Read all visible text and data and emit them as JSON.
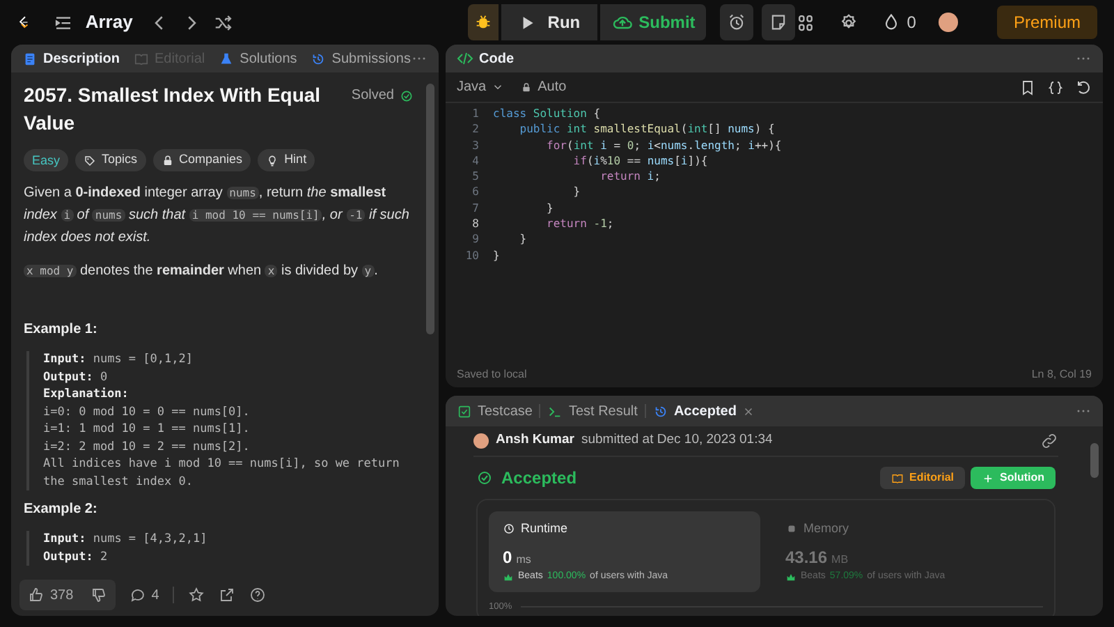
{
  "topbar": {
    "problem_list": "Array",
    "run": "Run",
    "submit": "Submit",
    "streak": "0",
    "premium": "Premium"
  },
  "left_tabs": [
    {
      "label": "Description",
      "selected": true,
      "disabled": false
    },
    {
      "label": "Editorial",
      "selected": false,
      "disabled": true
    },
    {
      "label": "Solutions",
      "selected": false,
      "disabled": false
    },
    {
      "label": "Submissions",
      "selected": false,
      "disabled": false
    }
  ],
  "problem": {
    "title": "2057. Smallest Index With Equal Value",
    "status": "Solved",
    "difficulty": "Easy",
    "tags": [
      {
        "label": "Topics"
      },
      {
        "label": "Companies"
      },
      {
        "label": "Hint"
      }
    ],
    "paragraphs": [
      [
        {
          "kind": "text",
          "text": "Given a **0-indexed** integer array "
        },
        {
          "kind": "code",
          "text": "nums"
        },
        {
          "kind": "text",
          "text": ", return *the* **smallest** *index* "
        },
        {
          "kind": "code",
          "text": "i"
        },
        {
          "kind": "text",
          "text": " *of* "
        },
        {
          "kind": "code",
          "text": "nums"
        },
        {
          "kind": "text",
          "text": " *such that* "
        },
        {
          "kind": "code",
          "text": "i mod 10 == nums[i]"
        },
        {
          "kind": "text",
          "text": "*, or* "
        },
        {
          "kind": "code",
          "text": "-1"
        },
        {
          "kind": "text",
          "text": " *if such index does not exist.*"
        }
      ],
      [
        {
          "kind": "code",
          "text": "x mod y"
        },
        {
          "kind": "text",
          "text": " denotes the **remainder** when "
        },
        {
          "kind": "code",
          "text": "x"
        },
        {
          "kind": "text",
          "text": " is divided by "
        },
        {
          "kind": "code",
          "text": "y"
        },
        {
          "kind": "text",
          "text": "."
        }
      ]
    ],
    "examples": [
      {
        "title": "Example 1:",
        "lines": [
          {
            "label": "Input:",
            "value": "nums = [0,1,2]"
          },
          {
            "label": "Output:",
            "value": "0"
          },
          {
            "label": "Explanation:"
          },
          {
            "value": "i=0: 0 mod 10 = 0 == nums[0]."
          },
          {
            "value": "i=1: 1 mod 10 = 1 == nums[1]."
          },
          {
            "value": "i=2: 2 mod 10 = 2 == nums[2]."
          },
          {
            "value": "All indices have i mod 10 == nums[i], so we return the smallest index 0."
          }
        ]
      },
      {
        "title": "Example 2:",
        "lines": [
          {
            "label": "Input:",
            "value": "nums = [4,3,2,1]"
          },
          {
            "label": "Output:",
            "value": "2"
          }
        ]
      }
    ]
  },
  "footer": {
    "likes": "378",
    "comments": "4"
  },
  "code_panel": {
    "title": "Code",
    "language": "Java",
    "mode": "Auto",
    "saved": "Saved to local",
    "cursor": "Ln 8, Col 19",
    "lines": [
      {
        "number": "1",
        "current": false,
        "tokens": [
          {
            "kind": "keyword",
            "text": "class "
          },
          {
            "kind": "type",
            "text": "Solution"
          },
          {
            "kind": "plain",
            "text": " {"
          }
        ]
      },
      {
        "number": "2",
        "current": false,
        "tokens": [
          {
            "kind": "keyword",
            "text": "    public "
          },
          {
            "kind": "type",
            "text": "int "
          },
          {
            "kind": "function",
            "text": "smallestEqual"
          },
          {
            "kind": "plain",
            "text": "("
          },
          {
            "kind": "type",
            "text": "int"
          },
          {
            "kind": "plain",
            "text": "[] "
          },
          {
            "kind": "variable",
            "text": "nums"
          },
          {
            "kind": "plain",
            "text": ") {"
          }
        ]
      },
      {
        "number": "3",
        "current": false,
        "tokens": [
          {
            "kind": "control",
            "text": "        for"
          },
          {
            "kind": "plain",
            "text": "("
          },
          {
            "kind": "type",
            "text": "int "
          },
          {
            "kind": "variable",
            "text": "i"
          },
          {
            "kind": "plain",
            "text": " = "
          },
          {
            "kind": "number",
            "text": "0"
          },
          {
            "kind": "plain",
            "text": "; "
          },
          {
            "kind": "variable",
            "text": "i"
          },
          {
            "kind": "plain",
            "text": "<"
          },
          {
            "kind": "variable",
            "text": "nums"
          },
          {
            "kind": "plain",
            "text": "."
          },
          {
            "kind": "variable",
            "text": "length"
          },
          {
            "kind": "plain",
            "text": "; "
          },
          {
            "kind": "variable",
            "text": "i"
          },
          {
            "kind": "plain",
            "text": "++){"
          }
        ]
      },
      {
        "number": "4",
        "current": false,
        "tokens": [
          {
            "kind": "control",
            "text": "            if"
          },
          {
            "kind": "plain",
            "text": "("
          },
          {
            "kind": "variable",
            "text": "i"
          },
          {
            "kind": "plain",
            "text": "%"
          },
          {
            "kind": "number",
            "text": "10"
          },
          {
            "kind": "plain",
            "text": " == "
          },
          {
            "kind": "variable",
            "text": "nums"
          },
          {
            "kind": "plain",
            "text": "["
          },
          {
            "kind": "variable",
            "text": "i"
          },
          {
            "kind": "plain",
            "text": "]){"
          }
        ]
      },
      {
        "number": "5",
        "current": false,
        "tokens": [
          {
            "kind": "control",
            "text": "                return "
          },
          {
            "kind": "variable",
            "text": "i"
          },
          {
            "kind": "plain",
            "text": ";"
          }
        ]
      },
      {
        "number": "6",
        "current": false,
        "tokens": [
          {
            "kind": "plain",
            "text": "            }"
          }
        ]
      },
      {
        "number": "7",
        "current": false,
        "tokens": [
          {
            "kind": "plain",
            "text": "        }"
          }
        ]
      },
      {
        "number": "8",
        "current": true,
        "tokens": [
          {
            "kind": "control",
            "text": "        return "
          },
          {
            "kind": "number",
            "text": "-1"
          },
          {
            "kind": "plain",
            "text": ";"
          }
        ]
      },
      {
        "number": "9",
        "current": false,
        "tokens": [
          {
            "kind": "plain",
            "text": "    }"
          }
        ]
      },
      {
        "number": "10",
        "current": false,
        "tokens": [
          {
            "kind": "plain",
            "text": "}"
          }
        ]
      }
    ]
  },
  "bottom_tabs": [
    {
      "label": "Testcase",
      "selected": false,
      "closable": false
    },
    {
      "label": "Test Result",
      "selected": false,
      "closable": false
    },
    {
      "label": "Accepted",
      "selected": true,
      "closable": true
    }
  ],
  "submission": {
    "user": "Ansh Kumar",
    "submitted": "submitted at Dec 10, 2023 01:34",
    "verdict": "Accepted",
    "editorial": "Editorial",
    "solution": "Solution",
    "metrics": [
      {
        "name": "Runtime",
        "selected": true,
        "value": "0",
        "unit": "ms",
        "beats_label": "Beats",
        "beats": "100.00%",
        "beats_suffix": "of users with Java"
      },
      {
        "name": "Memory",
        "selected": false,
        "value": "43.16",
        "unit": "MB",
        "beats_label": "Beats",
        "beats": "57.09%",
        "beats_suffix": "of users with Java"
      }
    ],
    "chart_axis_label": "100%"
  }
}
